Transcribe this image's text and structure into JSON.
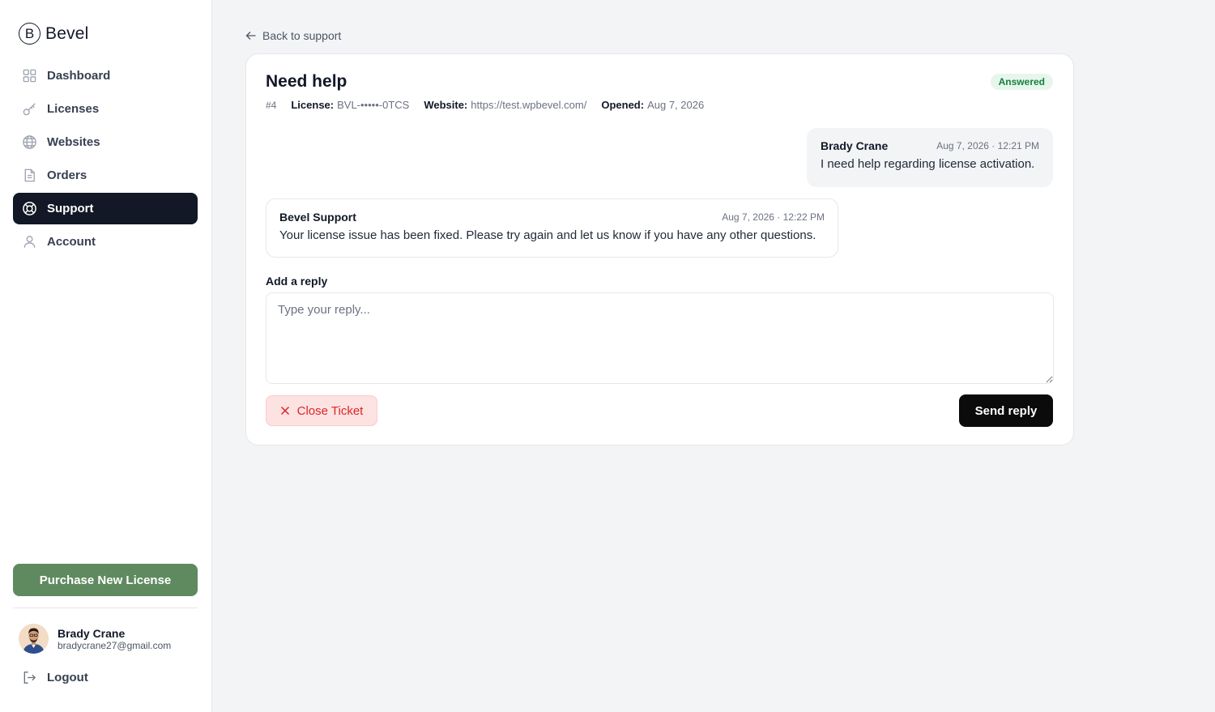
{
  "brand": {
    "logo_letter": "B",
    "name": "Bevel"
  },
  "sidebar": {
    "items": [
      {
        "label": "Dashboard",
        "icon": "grid-icon",
        "active": false
      },
      {
        "label": "Licenses",
        "icon": "key-icon",
        "active": false
      },
      {
        "label": "Websites",
        "icon": "globe-icon",
        "active": false
      },
      {
        "label": "Orders",
        "icon": "document-icon",
        "active": true
      },
      {
        "label": "Support",
        "icon": "lifebuoy-icon",
        "active": true
      },
      {
        "label": "Account",
        "icon": "user-icon",
        "active": false
      }
    ],
    "purchase_label": "Purchase New License",
    "user": {
      "name": "Brady Crane",
      "email": "bradycrane27@gmail.com"
    },
    "logout_label": "Logout"
  },
  "back_link": "Back to support",
  "ticket": {
    "title": "Need help",
    "status": "Answered",
    "number": "#4",
    "license_label": "License:",
    "license_value": "BVL-•••••-0TCS",
    "website_label": "Website:",
    "website_value": "https://test.wpbevel.com/",
    "opened_label": "Opened:",
    "opened_value": "Aug 7, 2026"
  },
  "messages": [
    {
      "author": "Brady Crane",
      "time": "Aug 7, 2026 · 12:21 PM",
      "body": "I need help regarding license activation."
    },
    {
      "author": "Bevel Support",
      "time": "Aug 7, 2026 · 12:22 PM",
      "body": "Your license issue has been fixed. Please try again and let us know if you have any other questions."
    }
  ],
  "reply": {
    "label": "Add a reply",
    "placeholder": "Type your reply...",
    "close_label": "Close Ticket",
    "send_label": "Send reply"
  },
  "colors": {
    "accent_dark": "#121826",
    "purchase_green": "#5f8a5f",
    "status_green": "#15803d",
    "danger_red": "#dc2626"
  }
}
